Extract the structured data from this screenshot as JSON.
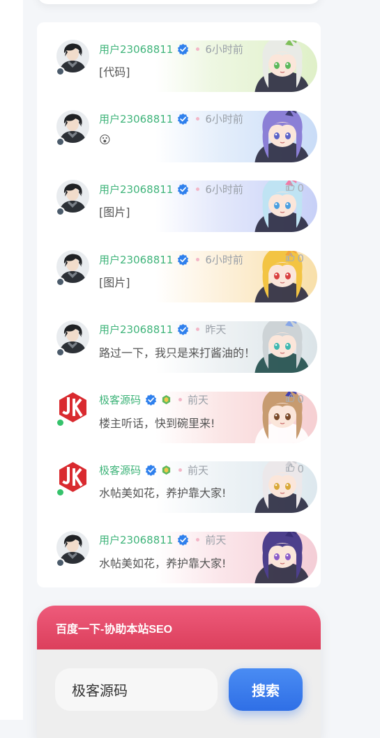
{
  "comments": [
    {
      "username": "用户23068811",
      "time": "6小时前",
      "likes": "",
      "text": "[代码]",
      "avatar": "user",
      "has_level": false,
      "status": "#4b5b6b",
      "banner": "linear-gradient(90deg,rgba(255,255,255,0) 0%,#eef7e2 35%,#dff0c8 100%)"
    },
    {
      "username": "用户23068811",
      "time": "6小时前",
      "likes": "",
      "text": "😮",
      "avatar": "user",
      "has_level": false,
      "status": "#4b5b6b",
      "banner": "linear-gradient(90deg,rgba(255,255,255,0) 0%,#e4eefb 40%,#c9dcf7 100%)"
    },
    {
      "username": "用户23068811",
      "time": "6小时前",
      "likes": "0",
      "text": "[图片]",
      "avatar": "user",
      "has_level": false,
      "status": "#4b5b6b",
      "banner": "linear-gradient(90deg,rgba(255,255,255,0) 0%,#e3e8fb 40%,#c7d0f7 100%)"
    },
    {
      "username": "用户23068811",
      "time": "6小时前",
      "likes": "0",
      "text": "[图片]",
      "avatar": "user",
      "has_level": false,
      "status": "#4b5b6b",
      "banner": "linear-gradient(90deg,rgba(255,255,255,0) 0%,#fdf1dc 40%,#f8dfa9 100%)"
    },
    {
      "username": "用户23068811",
      "time": "昨天",
      "likes": "",
      "text": "路过一下，我只是来打酱油的！",
      "avatar": "user",
      "has_level": false,
      "status": "#4b5b6b",
      "banner": "linear-gradient(90deg,rgba(255,255,255,0) 0%,#eef2f4 40%,#dbe4e8 100%)"
    },
    {
      "username": "极客源码",
      "time": "前天",
      "likes": "0",
      "text": "楼主听话，快到碗里来!",
      "avatar": "jk",
      "has_level": true,
      "status": "#35c26b",
      "banner": "linear-gradient(90deg,rgba(255,255,255,0) 0%,#fbe6e6 40%,#f6cfd2 100%)"
    },
    {
      "username": "极客源码",
      "time": "前天",
      "likes": "0",
      "text": "水帖美如花，养护靠大家!",
      "avatar": "jk",
      "has_level": true,
      "status": "#35c26b",
      "banner": "linear-gradient(90deg,rgba(255,255,255,0) 0%,#eef3f6 40%,#dde8ee 100%)"
    },
    {
      "username": "用户23068811",
      "time": "前天",
      "likes": "",
      "text": "水帖美如花，养护靠大家!",
      "avatar": "user",
      "has_level": false,
      "status": "#4b5b6b",
      "banner": "linear-gradient(90deg,rgba(255,255,255,0) 0%,#fbe6ea 40%,#f4cdd6 100%)"
    }
  ],
  "seo": {
    "title": "百度一下-协助本站SEO",
    "input_value": "极客源码",
    "button_label": "搜索"
  },
  "colors": {
    "username": "#3fb47a",
    "accent_red": "#dc3f5c",
    "button_blue": "#2f6fe6",
    "verified": "#2f80ed"
  }
}
